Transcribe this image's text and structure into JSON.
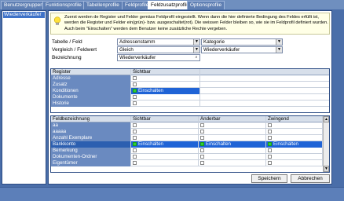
{
  "tabs": [
    {
      "label": "Benutzergruppen",
      "active": false
    },
    {
      "label": "Funktionsprofile",
      "active": false
    },
    {
      "label": "Tabellenprofile",
      "active": false
    },
    {
      "label": "Feldprofile",
      "active": false
    },
    {
      "label": "Feldzusatzprofile",
      "active": true
    },
    {
      "label": "Optionsprofile",
      "active": false
    }
  ],
  "left_list": {
    "items": [
      "Wiederverkäufer"
    ]
  },
  "info": {
    "text": "Zuerst werden de Register und Felder gemäss Feldprofil eingestellt. Wenn dann die hier definierte Bedingung des Feldes erfüllt ist, werden die Register und Felder ein(grün)- bzw. ausgeschaltet(rot). Die weissen Felder bleiben so, wie sie im Feldprofil definiert wurden. Auch beim \"Einschalten\" werden dem Benutzer keine zusätzliche Rechte vergeben."
  },
  "form": {
    "tabelle_label": "Tabelle / Feld",
    "tabelle_value": "Adressenstamm",
    "feld_value": "Kategorie",
    "vergleich_label": "Vergleich / Feldwert",
    "vergleich_value": "Gleich",
    "feldwert_value": "Wiederverkäufer",
    "bezeichnung_label": "Bezeichnung",
    "bezeichnung_value": "Wiederverkäufer"
  },
  "register_grid": {
    "headers": [
      "Register",
      "Sichtbar"
    ],
    "rows": [
      {
        "name": "Adresse",
        "sichtbar": ""
      },
      {
        "name": "Zusatz",
        "sichtbar": ""
      },
      {
        "name": "Konditionen",
        "sichtbar": "Einschalten"
      },
      {
        "name": "Dokumente",
        "sichtbar": ""
      },
      {
        "name": "Historie",
        "sichtbar": ""
      }
    ]
  },
  "field_grid": {
    "headers": [
      "Feldbezeichnung",
      "Sichtbar",
      "Änderbar",
      "Zwingend"
    ],
    "rows": [
      {
        "name": "aa",
        "sichtbar": "",
        "aenderbar": "",
        "zwingend": ""
      },
      {
        "name": "aaaaa",
        "sichtbar": "",
        "aenderbar": "",
        "zwingend": ""
      },
      {
        "name": "Anzahl Exemplare",
        "sichtbar": "",
        "aenderbar": "",
        "zwingend": ""
      },
      {
        "name": "Bankkonto",
        "sichtbar": "Einschalten",
        "aenderbar": "Einschalten",
        "zwingend": "Einschalten"
      },
      {
        "name": "Bemerkung",
        "sichtbar": "",
        "aenderbar": "",
        "zwingend": ""
      },
      {
        "name": "Dokumenten-Ordner",
        "sichtbar": "",
        "aenderbar": "",
        "zwingend": ""
      },
      {
        "name": "Eigentümer",
        "sichtbar": "",
        "aenderbar": "",
        "zwingend": ""
      }
    ]
  },
  "buttons": {
    "save": "Speichern",
    "cancel": "Abbrechen"
  },
  "icons": {
    "info": "lightbulb-icon",
    "dropdown": "chevron-down-icon",
    "search": "magnifier-icon"
  },
  "colors": {
    "accent": "#1f63d6",
    "enabled": "#2fd12f",
    "frame": "#4a6ea9"
  }
}
